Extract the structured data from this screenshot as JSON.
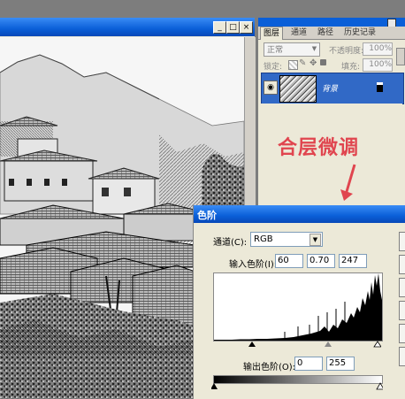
{
  "image_window": {
    "buttons": [
      "_",
      "□",
      "×"
    ]
  },
  "layers_panel": {
    "tabs": [
      "图层",
      "通道",
      "路径",
      "历史记录"
    ],
    "blend_mode": "正常",
    "opacity_label": "不透明度:",
    "opacity_value": "100%",
    "lock_label": "锁定:",
    "fill_label": "填充:",
    "fill_value": "100%",
    "layer_name": "背景"
  },
  "annotation": {
    "text": "合层微调",
    "color": "#e0454f"
  },
  "levels_dialog": {
    "title": "色阶",
    "channel_label": "通道(C):",
    "channel_value": "RGB",
    "input_label": "输入色阶(I):",
    "input_black": "60",
    "input_gamma": "0.70",
    "input_white": "247",
    "output_label": "输出色阶(O):",
    "output_black": "0",
    "output_white": "255"
  },
  "colors": {
    "xp_title": "#0a5fd8",
    "dialog_bg": "#ece9d8",
    "layer_selected": "#3169c6"
  }
}
